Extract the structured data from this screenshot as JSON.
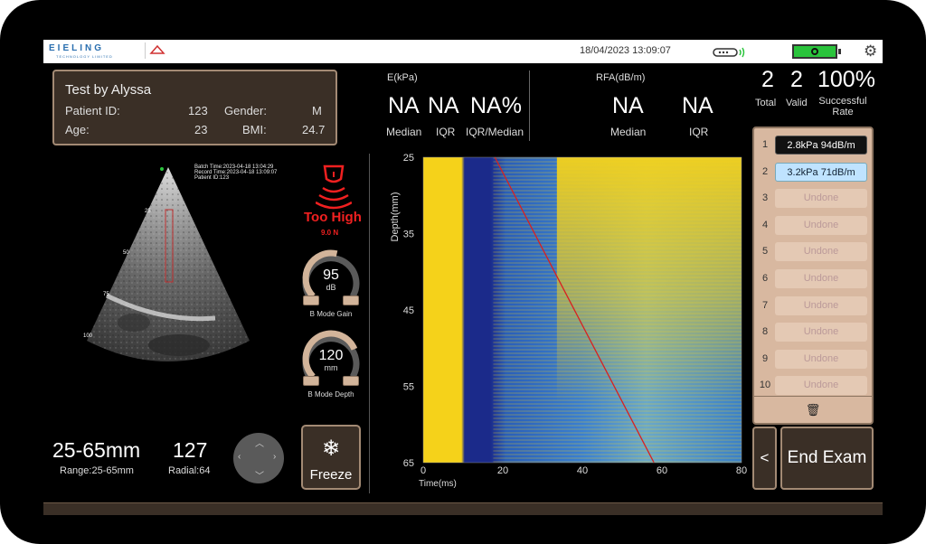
{
  "header": {
    "logo_text": "EIELING",
    "logo_sub": "TECHNOLOGY LIMITED",
    "datetime": "18/04/2023 13:09:07",
    "probe_icon": "probe-connected-icon",
    "battery_icon": "battery-full-icon",
    "battery_color": "#2ac43c",
    "settings_icon": "gear-icon"
  },
  "patient": {
    "name": "Test  by Alyssa",
    "id_label": "Patient ID:",
    "id_value": "123",
    "gender_label": "Gender:",
    "gender_value": "M",
    "age_label": "Age:",
    "age_value": "23",
    "bmi_label": "BMI:",
    "bmi_value": "24.7"
  },
  "e_panel": {
    "title": "E(kPa)",
    "median_value": "NA",
    "iqr_value": "NA",
    "ratio_value": "NA%",
    "median_label": "Median",
    "iqr_label": "IQR",
    "ratio_label": "IQR/Median"
  },
  "rfa_panel": {
    "title": "RFA(dB/m)",
    "median_value": "NA",
    "iqr_value": "NA",
    "median_label": "Median",
    "iqr_label": "IQR"
  },
  "stats": {
    "total_value": "2",
    "valid_value": "2",
    "rate_value": "100%",
    "total_label": "Total",
    "valid_label": "Valid",
    "rate_label_1": "Successful",
    "rate_label_2": "Rate"
  },
  "ultrasound": {
    "meta_1": "Batch Time:2023-04-18 13:04:29",
    "meta_2": "Record Time:2023-04-18 13:09:07",
    "meta_3": "Patient ID:123",
    "depth_marks": [
      "25",
      "50",
      "75",
      "100"
    ]
  },
  "pressure": {
    "status": "Too High",
    "force": "9.0 N",
    "status_color": "#f02020"
  },
  "gain": {
    "value": "95",
    "unit": "dB",
    "label": "B Mode Gain",
    "level": 0.55
  },
  "depth": {
    "value": "120",
    "unit": "mm",
    "label": "B Mode Depth",
    "level": 0.75
  },
  "range": {
    "value": "25-65mm",
    "label": "Range:25-65mm"
  },
  "radial": {
    "value": "127",
    "label": "Radial:64"
  },
  "freeze": {
    "label": "Freeze",
    "icon": "snowflake-icon"
  },
  "measurements": [
    {
      "index": "1",
      "text": "2.8kPa 94dB/m",
      "state": "done"
    },
    {
      "index": "2",
      "text": "3.2kPa 71dB/m",
      "state": "selected"
    },
    {
      "index": "3",
      "text": "Undone",
      "state": "undone"
    },
    {
      "index": "4",
      "text": "Undone",
      "state": "undone"
    },
    {
      "index": "5",
      "text": "Undone",
      "state": "undone"
    },
    {
      "index": "6",
      "text": "Undone",
      "state": "undone"
    },
    {
      "index": "7",
      "text": "Undone",
      "state": "undone"
    },
    {
      "index": "8",
      "text": "Undone",
      "state": "undone"
    },
    {
      "index": "9",
      "text": "Undone",
      "state": "undone"
    },
    {
      "index": "10",
      "text": "Undone",
      "state": "undone"
    }
  ],
  "trash_icon": "trash-icon",
  "prev_label": "<",
  "end_exam_label": "End Exam",
  "chart_data": {
    "type": "heatmap",
    "xlabel": "Time(ms)",
    "ylabel": "Depth(mm)",
    "xlim": [
      0,
      80
    ],
    "ylim": [
      25,
      65
    ],
    "xticks": [
      "0",
      "20",
      "40",
      "60",
      "80"
    ],
    "yticks": [
      "25",
      "35",
      "45",
      "55",
      "65"
    ],
    "line": {
      "x": [
        18,
        58
      ],
      "y": [
        25,
        65
      ],
      "color": "#d82020"
    },
    "colors": {
      "high": "#f5d21a",
      "mid": "#3a7fd0",
      "low": "#1b2a8a"
    }
  }
}
